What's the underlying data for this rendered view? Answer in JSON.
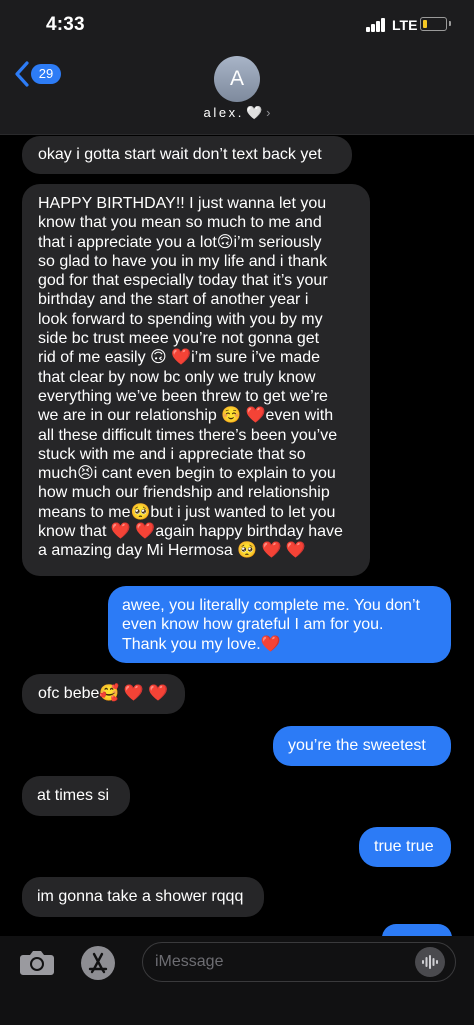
{
  "status_bar": {
    "time": "4:33",
    "network": "LTE",
    "battery_level": 0.22,
    "battery_color": "#f3c623"
  },
  "header": {
    "back_count": "29",
    "avatar_initial": "A",
    "contact_name": "alex.",
    "contact_emoji": "🤍",
    "chevron": "›"
  },
  "messages": [
    {
      "side": "received",
      "text": "okay i gotta start wait don’t text back yet"
    },
    {
      "side": "received",
      "text": "HAPPY BIRTHDAY!! I just wanna let you\nknow that you mean so much to me and\nthat i appreciate you a lot🙃i’m seriously\nso glad to have you in my life and i thank\ngod for that especially today that it’s your\nbirthday and the start of another year i\nlook forward to spending with you by my\nside bc trust meee you’re not gonna get\nrid of me easily 🙃 ❤️i’m sure i’ve made\nthat clear by now bc only we truly know\neverything we’ve been threw to get we’re\nwe are in our relationship ☺️ ❤️even with\nall these difficult times there’s been you’ve\nstuck with me and i appreciate that so\nmuch😣i cant even begin to explain to you\nhow much our friendship and relationship\nmeans to me🥺but i just wanted to let you\nknow that ❤️ ❤️again happy birthday have\na amazing day Mi Hermosa 🥺 ❤️ ❤️"
    },
    {
      "side": "sent",
      "text": "awee, you literally complete me. You don’t\neven know how grateful I am for you.\nThank you my love.❤️"
    },
    {
      "side": "received",
      "text": "ofc bebe🥰 ❤️ ❤️"
    },
    {
      "side": "sent",
      "text": "you’re the sweetest"
    },
    {
      "side": "received",
      "text": "at times si"
    },
    {
      "side": "sent",
      "text": "true true"
    },
    {
      "side": "received",
      "text": "im gonna take a shower rqqq"
    }
  ],
  "input": {
    "placeholder": "iMessage",
    "camera_icon": "camera-icon",
    "apps_icon": "app-store-icon",
    "audio_icon": "audio-waveform-icon"
  },
  "colors": {
    "sent_bubble": "#2c7bf6",
    "received_bubble": "#262628",
    "header_bg": "#1c1c1e",
    "accent": "#2d7cf6"
  }
}
